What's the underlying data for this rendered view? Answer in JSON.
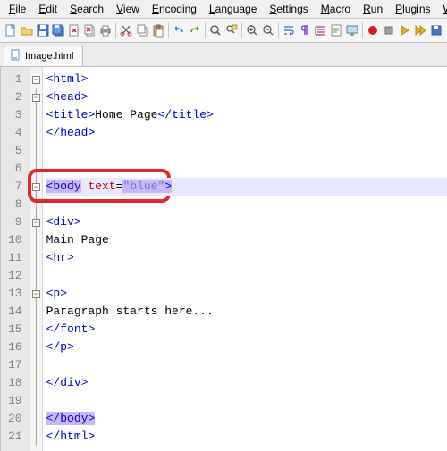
{
  "menu": {
    "file": "File",
    "edit": "Edit",
    "search": "Search",
    "view": "View",
    "encoding": "Encoding",
    "language": "Language",
    "settings": "Settings",
    "macro": "Macro",
    "run": "Run",
    "plugins": "Plugins",
    "window": "Window",
    "help": "?"
  },
  "tab": {
    "label": "Image.html"
  },
  "gutter": {
    "l1": "1",
    "l2": "2",
    "l3": "3",
    "l4": "4",
    "l5": "5",
    "l6": "6",
    "l7": "7",
    "l8": "8",
    "l9": "9",
    "l10": "10",
    "l11": "11",
    "l12": "12",
    "l13": "13",
    "l14": "14",
    "l15": "15",
    "l16": "16",
    "l17": "17",
    "l18": "18",
    "l19": "19",
    "l20": "20",
    "l21": "21"
  },
  "code": {
    "l1": {
      "open": "<",
      "tag": "html",
      "close": ">"
    },
    "l2": {
      "open": "<",
      "tag": "head",
      "close": ">"
    },
    "l3": {
      "open1": "<",
      "tag1": "title",
      "close1": ">",
      "text": "Home Page",
      "open2": "</",
      "tag2": "title",
      "close2": ">"
    },
    "l4": {
      "open": "</",
      "tag": "head",
      "close": ">"
    },
    "l7": {
      "open": "<",
      "tag": "body",
      "sp": " ",
      "attr": "text",
      "eq": "=",
      "q1": "\"",
      "val": "blue",
      "q2": "\"",
      "close": ">"
    },
    "l9": {
      "open": "<",
      "tag": "div",
      "close": ">"
    },
    "l10": {
      "text": "Main Page"
    },
    "l11": {
      "open": "<",
      "tag": "hr",
      "close": ">"
    },
    "l13": {
      "open": "<",
      "tag": "p",
      "close": ">"
    },
    "l14": {
      "text": "Paragraph starts here..."
    },
    "l15": {
      "open": "</",
      "tag": "font",
      "close": ">"
    },
    "l16": {
      "open": "</",
      "tag": "p",
      "close": ">"
    },
    "l18": {
      "open": "</",
      "tag": "div",
      "close": ">"
    },
    "l20": {
      "open": "</",
      "tag": "body",
      "close": ">"
    },
    "l21": {
      "open": "</",
      "tag": "html",
      "close": ">"
    }
  },
  "icons": {
    "new": "new-file",
    "open": "open-file",
    "save": "save",
    "saveall": "save-all",
    "close": "close-file",
    "closeall": "close-all",
    "print": "print",
    "cut": "cut",
    "copy": "copy",
    "paste": "paste",
    "undo": "undo",
    "redo": "redo",
    "find": "find",
    "replace": "replace",
    "zoomin": "zoom-in",
    "zoomout": "zoom-out",
    "wrap": "word-wrap",
    "ws": "show-whitespace",
    "guide": "indent-guide",
    "lang": "language",
    "monitor": "monitor",
    "record": "macro-record",
    "stop": "macro-stop",
    "play": "macro-play",
    "playm": "macro-play-multi",
    "savemac": "macro-save"
  }
}
